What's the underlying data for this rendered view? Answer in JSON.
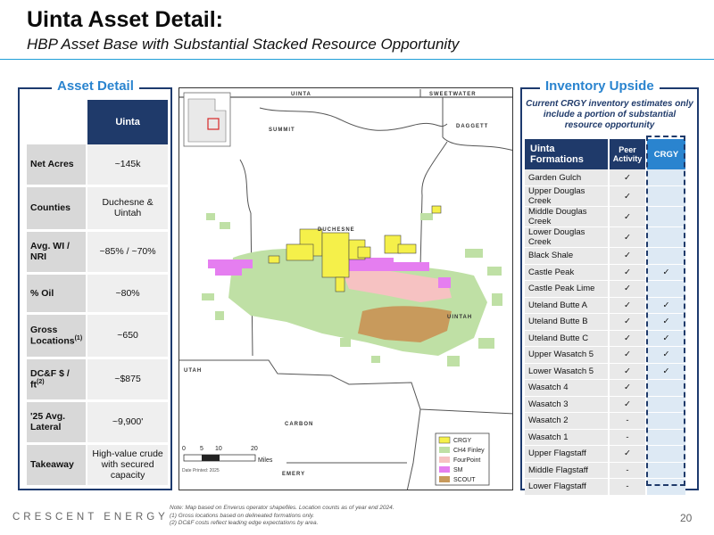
{
  "header": {
    "title": "Uinta Asset Detail:",
    "subtitle": "HBP Asset Base with Substantial Stacked Resource Opportunity"
  },
  "asset_detail": {
    "heading": "Asset Detail",
    "column_header": "Uinta",
    "rows": [
      {
        "label": "Net Acres",
        "value": "~145k"
      },
      {
        "label": "Counties",
        "value": "Duchesne & Uintah"
      },
      {
        "label": "Avg. WI / NRI",
        "value": "~85% / ~70%"
      },
      {
        "label": "% Oil",
        "value": "~80%"
      },
      {
        "label": "Gross Locations",
        "label_sup": "(1)",
        "value": "~650"
      },
      {
        "label": "DC&F $ / ft",
        "label_sup": "(2)",
        "value": "~$875"
      },
      {
        "label": "'25 Avg. Lateral",
        "value": "~9,900'"
      },
      {
        "label": "Takeaway",
        "value": "High-value crude with secured capacity"
      }
    ]
  },
  "map": {
    "county_labels": {
      "uinta": "UINTA",
      "sweetwater": "SWEETWATER",
      "summit": "SUMMIT",
      "daggett": "DAGGETT",
      "duchesne": "DUCHESNE",
      "uintah": "UINTAH",
      "utah": "UTAH",
      "carbon": "CARBON",
      "emery": "EMERY"
    },
    "scale": {
      "ticks": [
        "0",
        "5",
        "10",
        "20"
      ],
      "unit": "Miles"
    },
    "date_printed": "Date Printed: 2025",
    "legend": [
      {
        "name": "CRGY",
        "color": "#f5f04a"
      },
      {
        "name": "CH4 Finley",
        "color": "#bfe0a5"
      },
      {
        "name": "FourPoint",
        "color": "#f6c2c2"
      },
      {
        "name": "SM",
        "color": "#e57ef0"
      },
      {
        "name": "SCOUT",
        "color": "#c89a5c"
      }
    ]
  },
  "inventory": {
    "heading": "Inventory Upside",
    "subheading": "Current CRGY inventory estimates only include a portion of substantial resource opportunity",
    "columns": {
      "formation": "Uinta Formations",
      "peer": "Peer Activity",
      "crgy": "CRGY"
    },
    "rows": [
      {
        "name": "Garden Gulch",
        "peer": "✓",
        "crgy": ""
      },
      {
        "name": "Upper Douglas Creek",
        "peer": "✓",
        "crgy": ""
      },
      {
        "name": "Middle Douglas Creek",
        "peer": "✓",
        "crgy": ""
      },
      {
        "name": "Lower Douglas Creek",
        "peer": "✓",
        "crgy": ""
      },
      {
        "name": "Black Shale",
        "peer": "✓",
        "crgy": ""
      },
      {
        "name": "Castle Peak",
        "peer": "✓",
        "crgy": "✓"
      },
      {
        "name": "Castle Peak Lime",
        "peer": "✓",
        "crgy": ""
      },
      {
        "name": "Uteland Butte A",
        "peer": "✓",
        "crgy": "✓"
      },
      {
        "name": "Uteland Butte B",
        "peer": "✓",
        "crgy": "✓"
      },
      {
        "name": "Uteland Butte C",
        "peer": "✓",
        "crgy": "✓"
      },
      {
        "name": "Upper Wasatch 5",
        "peer": "✓",
        "crgy": "✓"
      },
      {
        "name": "Lower Wasatch 5",
        "peer": "✓",
        "crgy": "✓"
      },
      {
        "name": "Wasatch 4",
        "peer": "✓",
        "crgy": ""
      },
      {
        "name": "Wasatch 3",
        "peer": "✓",
        "crgy": ""
      },
      {
        "name": "Wasatch 2",
        "peer": "-",
        "crgy": ""
      },
      {
        "name": "Wasatch 1",
        "peer": "-",
        "crgy": ""
      },
      {
        "name": "Upper Flagstaff",
        "peer": "✓",
        "crgy": ""
      },
      {
        "name": "Middle Flagstaff",
        "peer": "-",
        "crgy": ""
      },
      {
        "name": "Lower Flagstaff",
        "peer": "-",
        "crgy": ""
      }
    ]
  },
  "footer": {
    "logo": "CRESCENT ENERGY",
    "notes": [
      "Note: Map based on Enverus operator shapefiles. Location counts as of year end 2024.",
      "(1)      Gross locations based on delineated formations only.",
      "(2)      DC&F costs reflect leading edge expectations by area."
    ],
    "page_number": "20"
  }
}
